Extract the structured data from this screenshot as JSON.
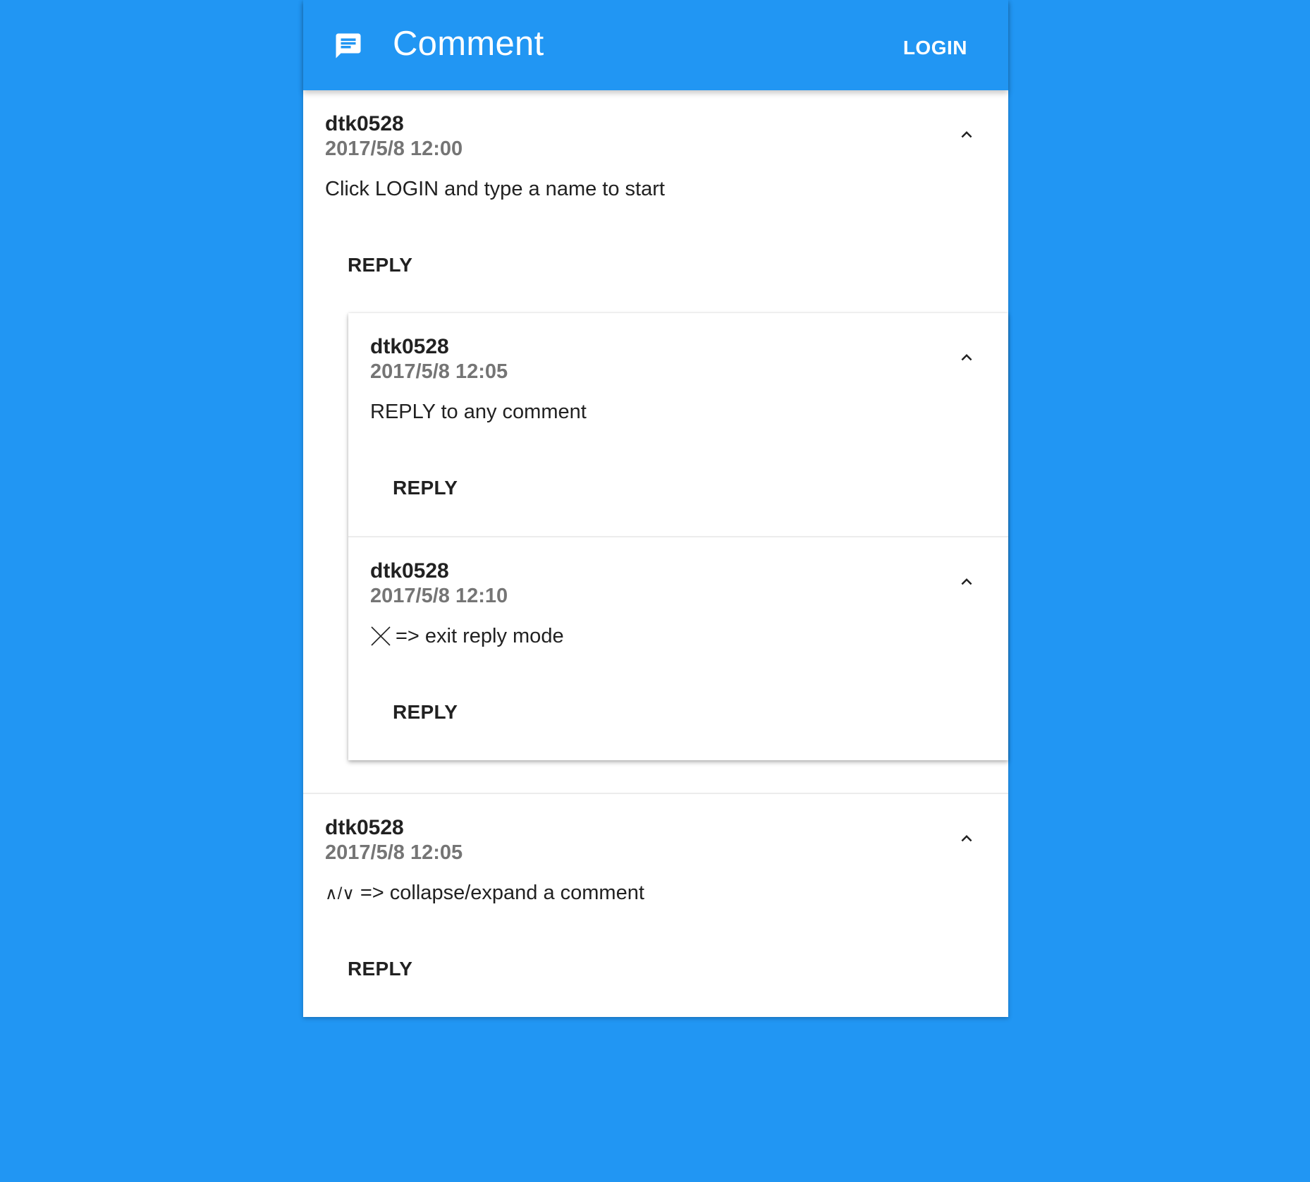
{
  "colors": {
    "background": "#2196F3",
    "appbar": "#2196F3",
    "card": "#ffffff",
    "author": "#212121",
    "timestamp": "#757575"
  },
  "appbar": {
    "icon": "comment-icon",
    "title": "Comment",
    "login_label": "LOGIN"
  },
  "comments": [
    {
      "author": "dtk0528",
      "timestamp": "2017/5/8 12:00",
      "body": "Click LOGIN and type a name to start",
      "reply_label": "REPLY",
      "collapse_icon": "chevron-up-icon",
      "replies": [
        {
          "author": "dtk0528",
          "timestamp": "2017/5/8 12:05",
          "body": "REPLY to any comment",
          "reply_label": "REPLY",
          "collapse_icon": "chevron-up-icon"
        },
        {
          "author": "dtk0528",
          "timestamp": "2017/5/8 12:10",
          "body_icon": "close-icon",
          "body": "=> exit reply mode",
          "reply_label": "REPLY",
          "collapse_icon": "chevron-up-icon"
        }
      ]
    },
    {
      "author": "dtk0528",
      "timestamp": "2017/5/8 12:05",
      "body_prefix": "∧/∨",
      "body": " => collapse/expand a comment",
      "reply_label": "REPLY",
      "collapse_icon": "chevron-up-icon"
    }
  ]
}
